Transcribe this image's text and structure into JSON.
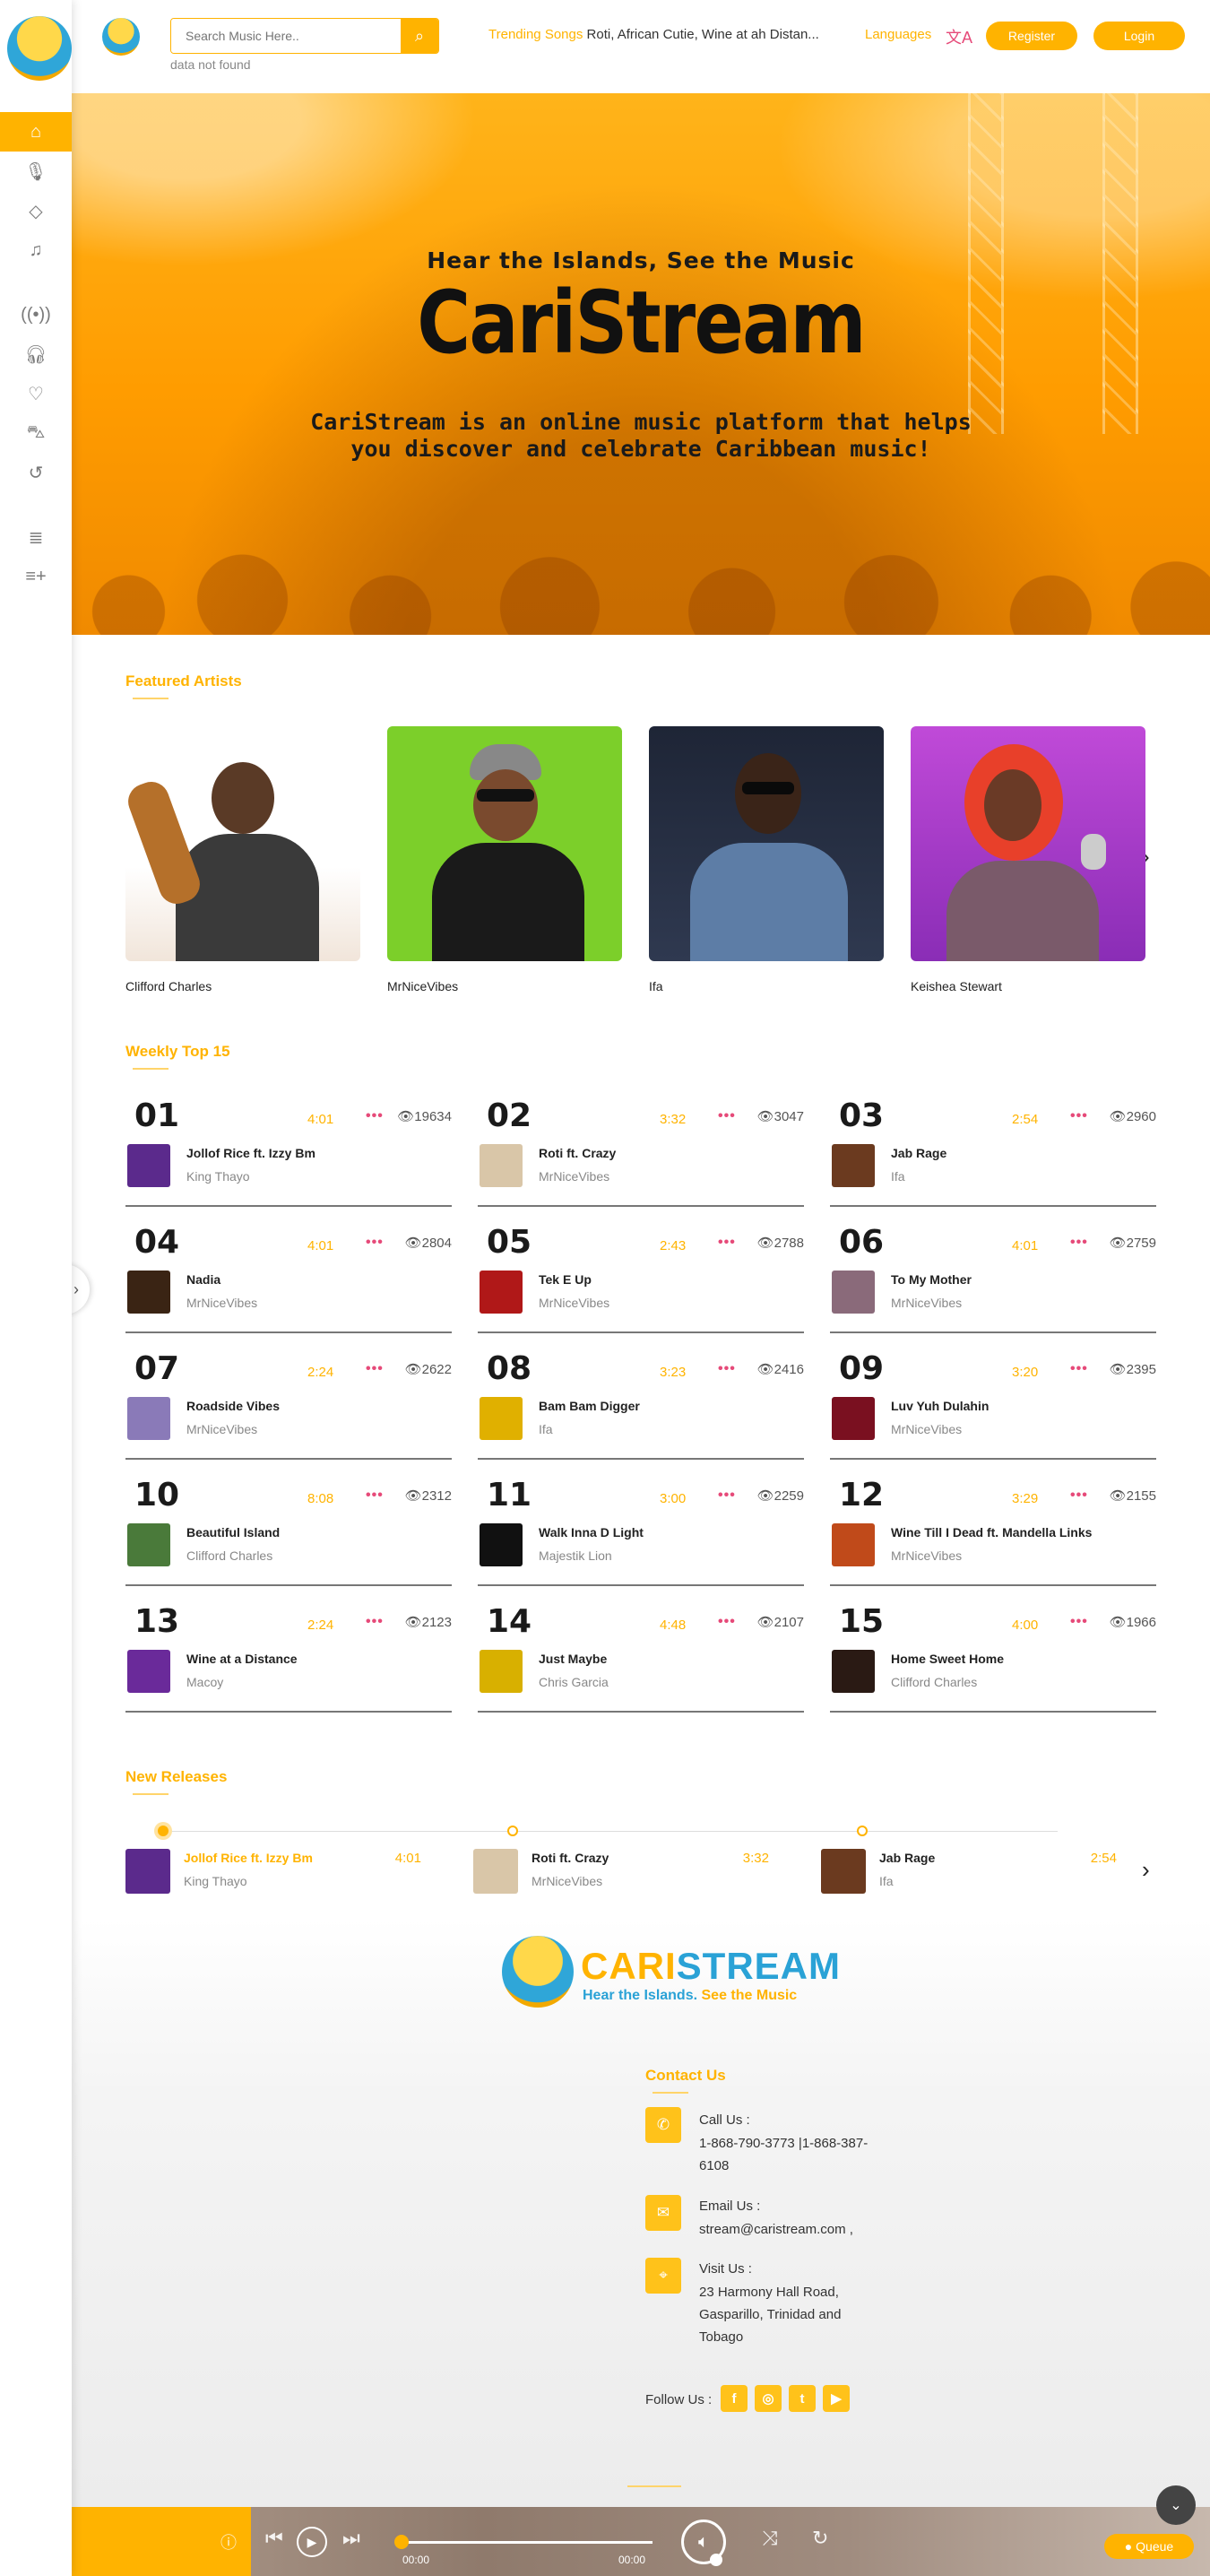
{
  "header": {
    "search_placeholder": "Search Music Here..",
    "search_status": "data not found",
    "trending_label": "Trending Songs",
    "trending_songs": "Roti, African Cutie, Wine at ah Distan...",
    "languages_label": "Languages",
    "register_label": "Register",
    "login_label": "Login"
  },
  "sidebar": {
    "items": [
      {
        "icon": "home-icon",
        "active": true
      },
      {
        "icon": "microphone-icon"
      },
      {
        "icon": "diamond-icon"
      },
      {
        "icon": "music-book-icon"
      },
      {
        "icon": "radio-icon"
      },
      {
        "icon": "headphones-icon"
      },
      {
        "icon": "heart-icon"
      },
      {
        "icon": "shopping-bag-icon"
      },
      {
        "icon": "history-icon"
      },
      {
        "icon": "playlist-icon"
      },
      {
        "icon": "add-playlist-icon"
      }
    ]
  },
  "hero": {
    "tagline": "Hear the Islands, See the Music",
    "title": "CariStream",
    "description": "CariStream is an online music platform that helps you discover and celebrate Caribbean music!"
  },
  "featured": {
    "title": "Featured Artists",
    "artists": [
      {
        "name": "Clifford Charles"
      },
      {
        "name": "MrNiceVibes"
      },
      {
        "name": "Ifa"
      },
      {
        "name": "Keishea Stewart"
      }
    ]
  },
  "top15": {
    "title": "Weekly Top 15",
    "tracks": [
      {
        "rank": "01",
        "duration": "4:01",
        "views": "19634",
        "title": "Jollof Rice ft. Izzy Bm",
        "artist": "King Thayo",
        "color": "#5b2a8c"
      },
      {
        "rank": "02",
        "duration": "3:32",
        "views": "3047",
        "title": "Roti ft. Crazy",
        "artist": "MrNiceVibes",
        "color": "#d9c6a8"
      },
      {
        "rank": "03",
        "duration": "2:54",
        "views": "2960",
        "title": "Jab Rage",
        "artist": "Ifa",
        "color": "#6b3a1f"
      },
      {
        "rank": "04",
        "duration": "4:01",
        "views": "2804",
        "title": "Nadia",
        "artist": "MrNiceVibes",
        "color": "#3a2414"
      },
      {
        "rank": "05",
        "duration": "2:43",
        "views": "2788",
        "title": "Tek E Up",
        "artist": "MrNiceVibes",
        "color": "#b01818"
      },
      {
        "rank": "06",
        "duration": "4:01",
        "views": "2759",
        "title": "To My Mother",
        "artist": "MrNiceVibes",
        "color": "#8a6a7a"
      },
      {
        "rank": "07",
        "duration": "2:24",
        "views": "2622",
        "title": "Roadside Vibes",
        "artist": "MrNiceVibes",
        "color": "#8a7ab8"
      },
      {
        "rank": "08",
        "duration": "3:23",
        "views": "2416",
        "title": "Bam Bam Digger",
        "artist": "Ifa",
        "color": "#e0b000"
      },
      {
        "rank": "09",
        "duration": "3:20",
        "views": "2395",
        "title": "Luv Yuh Dulahin",
        "artist": "MrNiceVibes",
        "color": "#7a1020"
      },
      {
        "rank": "10",
        "duration": "8:08",
        "views": "2312",
        "title": "Beautiful Island",
        "artist": "Clifford Charles",
        "color": "#4a7a3a"
      },
      {
        "rank": "11",
        "duration": "3:00",
        "views": "2259",
        "title": "Walk Inna D Light",
        "artist": "Majestik Lion",
        "color": "#111111"
      },
      {
        "rank": "12",
        "duration": "3:29",
        "views": "2155",
        "title": "Wine Till I Dead ft. Mandella Links",
        "artist": "MrNiceVibes",
        "color": "#c04a1a"
      },
      {
        "rank": "13",
        "duration": "2:24",
        "views": "2123",
        "title": "Wine at a Distance",
        "artist": "Macoy",
        "color": "#6a2a9a"
      },
      {
        "rank": "14",
        "duration": "4:48",
        "views": "2107",
        "title": "Just Maybe",
        "artist": "Chris Garcia",
        "color": "#d8b000"
      },
      {
        "rank": "15",
        "duration": "4:00",
        "views": "1966",
        "title": "Home Sweet Home",
        "artist": "Clifford Charles",
        "color": "#2a1a14"
      }
    ]
  },
  "releases": {
    "title": "New Releases",
    "items": [
      {
        "title": "Jollof Rice ft. Izzy Bm",
        "artist": "King Thayo",
        "duration": "4:01",
        "color": "#5b2a8c"
      },
      {
        "title": "Roti ft. Crazy",
        "artist": "MrNiceVibes",
        "duration": "3:32",
        "color": "#d9c6a8"
      },
      {
        "title": "Jab Rage",
        "artist": "Ifa",
        "duration": "2:54",
        "color": "#6b3a1f"
      }
    ]
  },
  "footer": {
    "brand_a": "CARI",
    "brand_b": "STREAM",
    "slogan_a": "Hear the Islands.",
    "slogan_b": "See the Music",
    "contact_title": "Contact Us",
    "call_label": "Call Us :",
    "call_value": "1-868-790-3773 |1-868-387-6108",
    "email_label": "Email Us :",
    "email_value": "stream@caristream.com ,",
    "visit_label": "Visit Us :",
    "visit_value": "23 Harmony Hall Road, Gasparillo, Trinidad and Tobago",
    "follow_label": "Follow Us :"
  },
  "player": {
    "time_current": "00:00",
    "time_total": "00:00",
    "queue_label": "Queue"
  }
}
